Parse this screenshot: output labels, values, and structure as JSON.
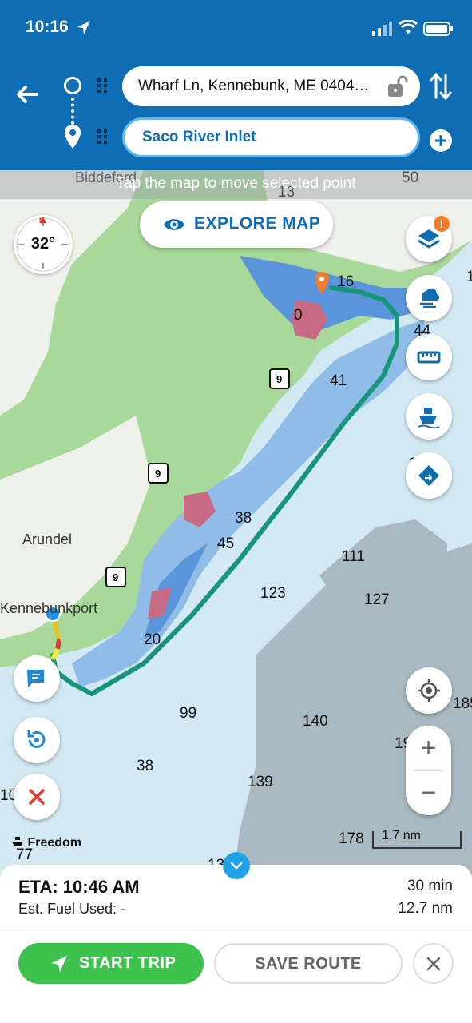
{
  "status_bar": {
    "time": "10:16"
  },
  "route": {
    "origin": "Wharf Ln, Kennebunk, ME 0404…",
    "destination": "Saco River Inlet"
  },
  "map": {
    "hint": "Tap the map to move selected point",
    "explore_label": "EXPLORE MAP",
    "compass_heading": "32°",
    "compass_n": "N",
    "place_labels": [
      "Biddeford",
      "Arundel",
      "Kennebunkport"
    ],
    "route_shields": [
      "9",
      "9",
      "9"
    ],
    "depths": [
      "50",
      "13",
      "16",
      "0",
      "44",
      "41",
      "38",
      "45",
      "111",
      "123",
      "127",
      "20",
      "99",
      "140",
      "19",
      "185",
      "38",
      "139",
      "178",
      "10",
      "77",
      "13",
      "1",
      "3"
    ],
    "layers_badge": "!",
    "vessel_name": "Freedom",
    "scale": "1.7 nm",
    "zoom_in": "+",
    "zoom_out": "−"
  },
  "trip": {
    "eta": "ETA: 10:46 AM",
    "fuel": "Est. Fuel Used: -",
    "duration": "30 min",
    "distance": "12.7 nm",
    "start_label": "START TRIP",
    "save_label": "SAVE ROUTE"
  },
  "colors": {
    "header": "#0f6db3",
    "route": "#17957a",
    "start": "#3cc24d",
    "land": "#a9d99a",
    "water": "#d2e9f3"
  }
}
